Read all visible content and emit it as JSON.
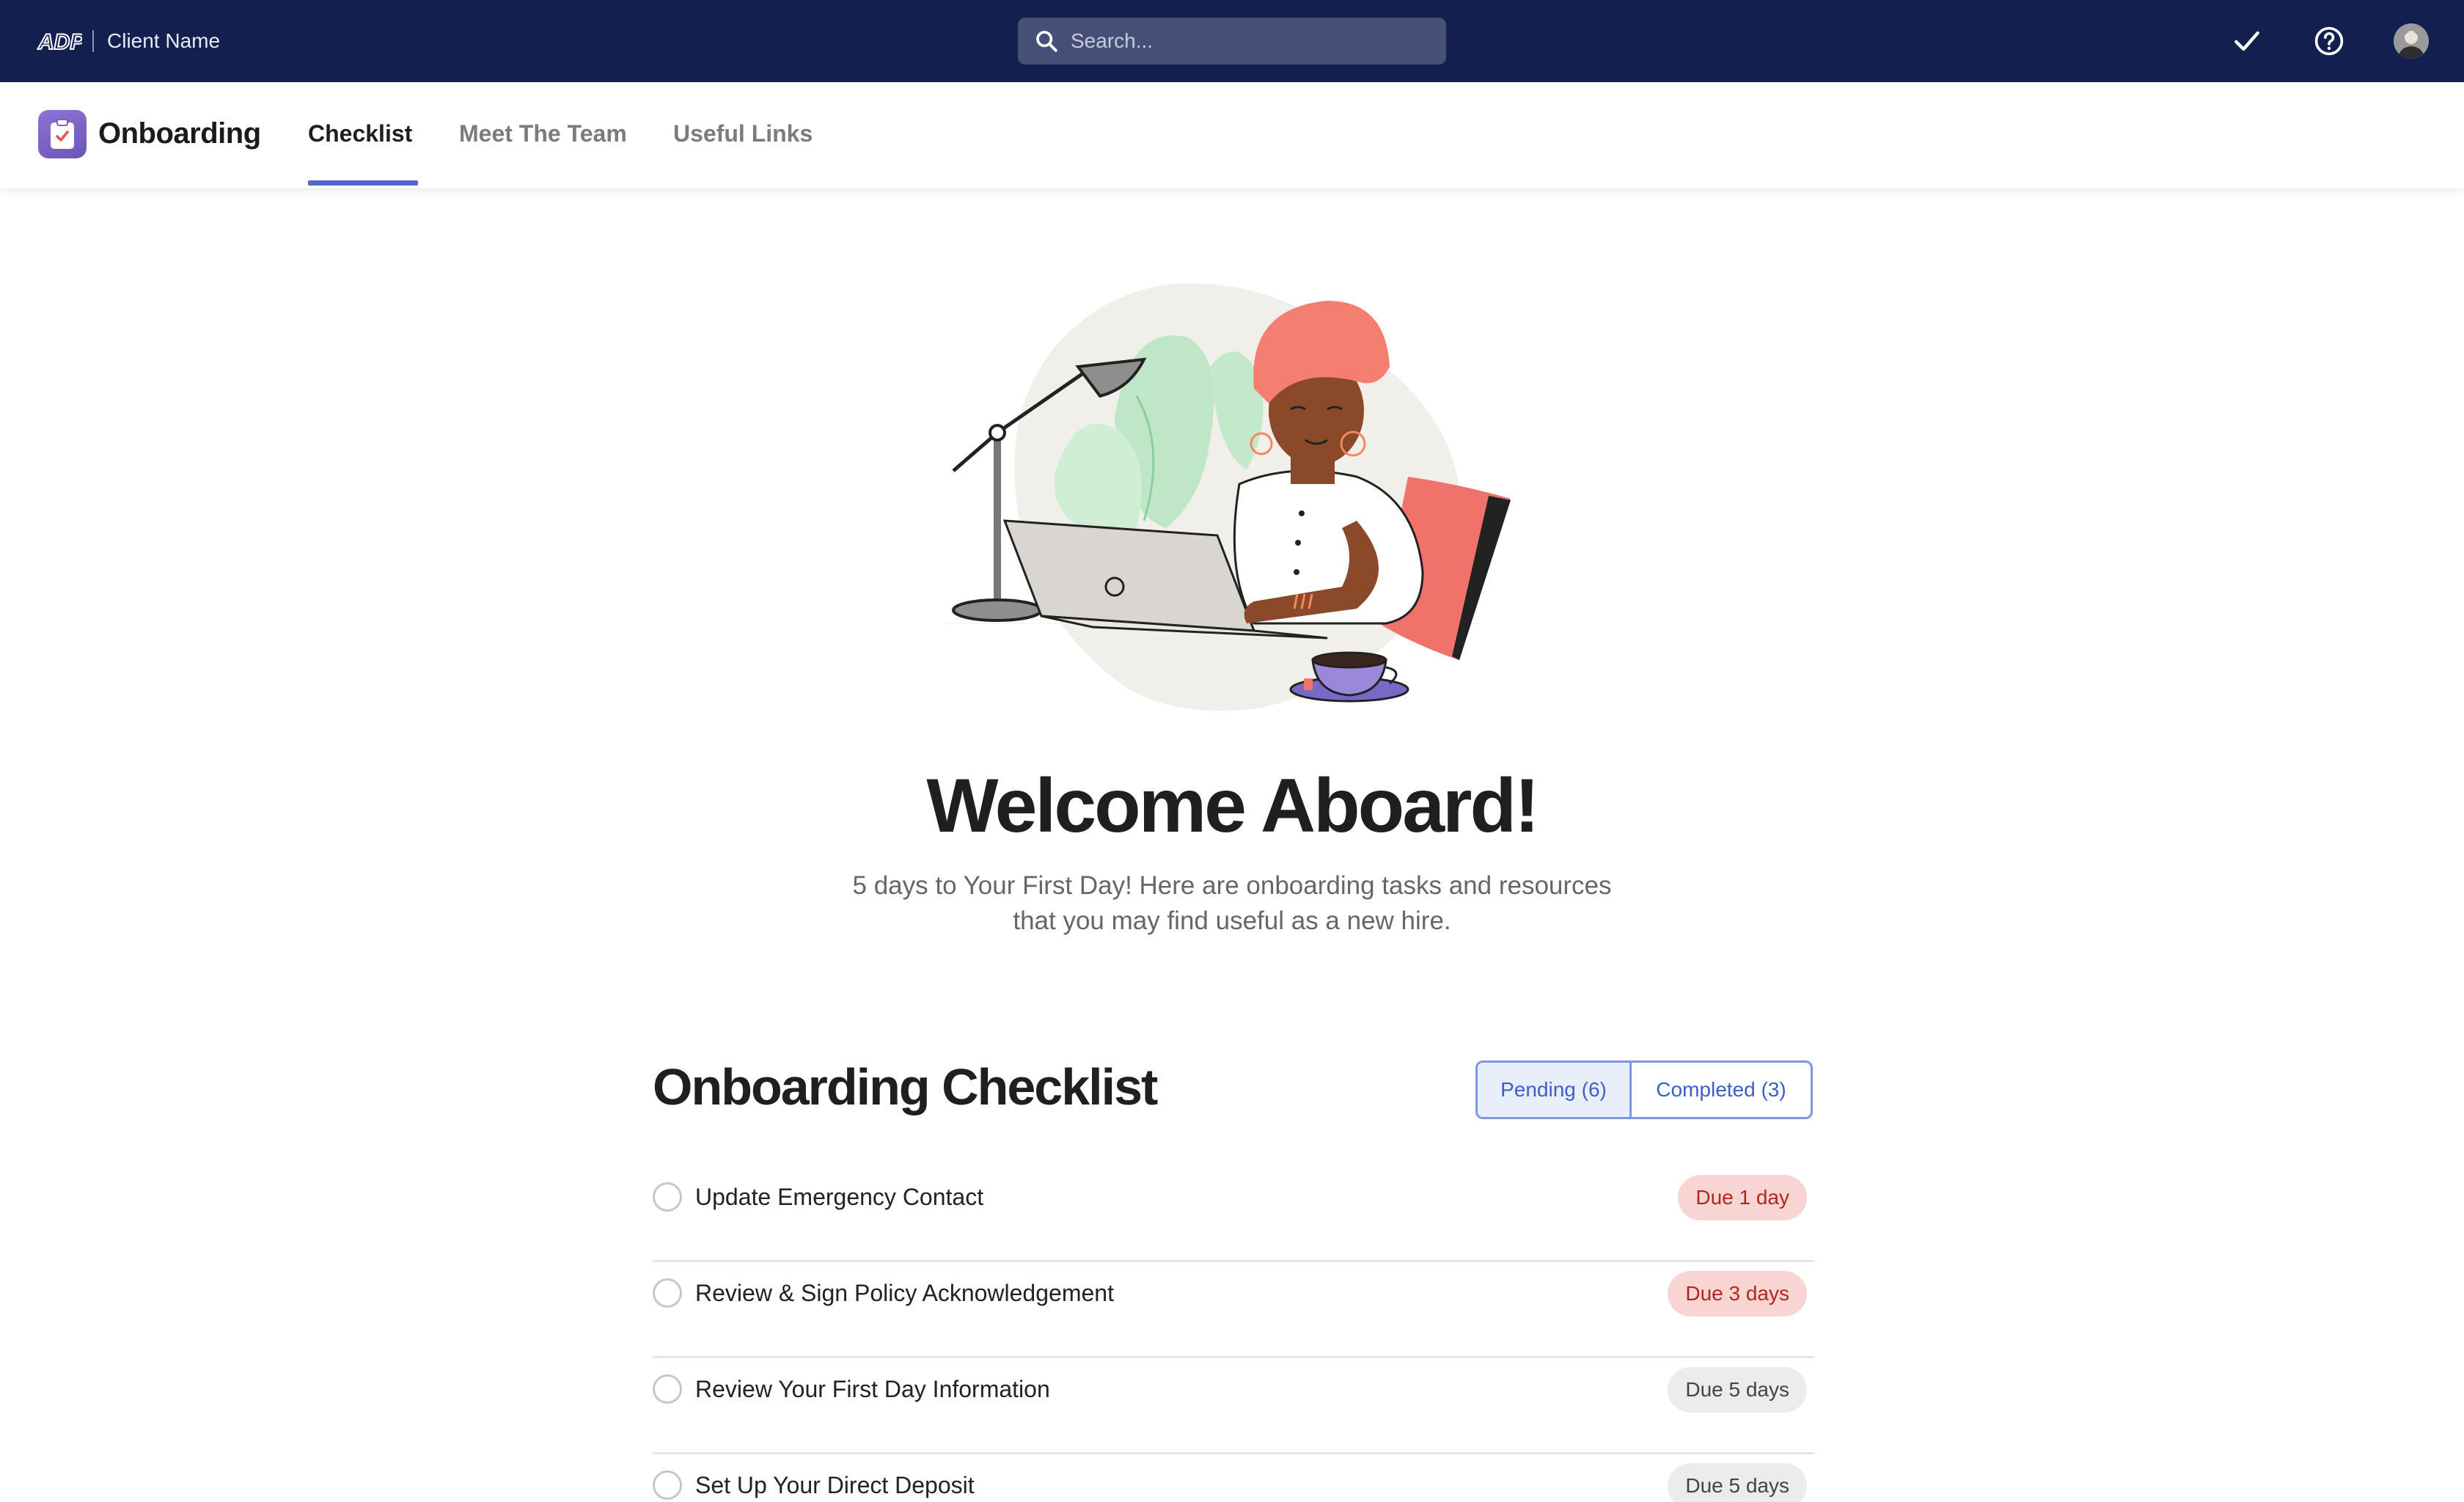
{
  "topbar": {
    "logo_text": "ADP",
    "client_name": "Client Name",
    "search_placeholder": "Search...",
    "icons": [
      "checkmark-icon",
      "help-icon"
    ],
    "avatar": "user-avatar"
  },
  "subnav": {
    "app_title": "Onboarding",
    "tabs": [
      {
        "label": "Checklist",
        "active": true
      },
      {
        "label": "Meet The Team",
        "active": false
      },
      {
        "label": "Useful Links",
        "active": false
      }
    ]
  },
  "hero": {
    "title": "Welcome Aboard!",
    "subtitle_line1": "5 days to Your First Day! Here are onboarding tasks and resources",
    "subtitle_line2": "that you may find useful as a new hire."
  },
  "checklist": {
    "title": "Onboarding Checklist",
    "filter": {
      "pending_label": "Pending (6)",
      "completed_label": "Completed (3)",
      "selected": "pending"
    },
    "items": [
      {
        "label": "Update Emergency Contact",
        "due": "Due 1 day",
        "urgent": true
      },
      {
        "label": "Review & Sign Policy Acknowledgement",
        "due": "Due 3 days",
        "urgent": true
      },
      {
        "label": "Review Your First Day Information",
        "due": "Due 5 days",
        "urgent": false
      },
      {
        "label": "Set Up Your Direct Deposit",
        "due": "Due 5 days",
        "urgent": false
      }
    ]
  },
  "colors": {
    "navy": "#131f4f",
    "accent": "#4f68c9",
    "urgent_bg": "#f8d5d3",
    "urgent_text": "#b3261e"
  }
}
